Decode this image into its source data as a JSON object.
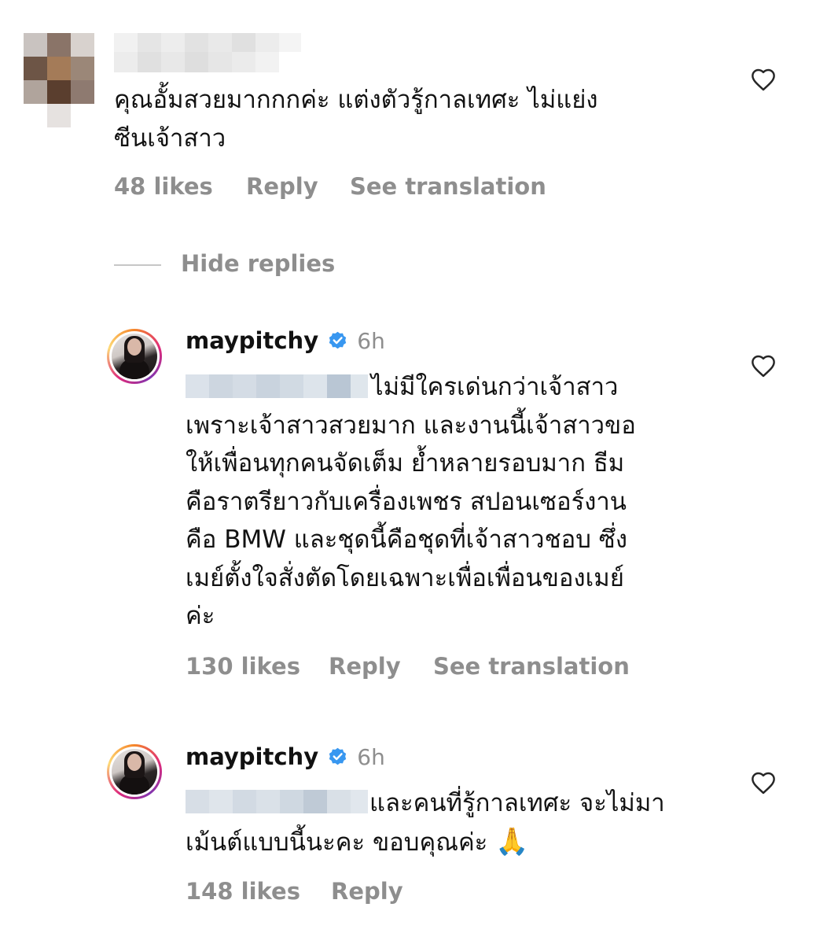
{
  "comment": {
    "text_line1": "คุณอั้มสวยมากกกค่ะ แต่งตัวรู้กาลเทศะ ไม่แย่ง",
    "text_line2": "ซีนเจ้าสาว",
    "likes": "48 likes",
    "reply": "Reply",
    "see_translation": "See translation"
  },
  "hide_replies": "Hide replies",
  "replies": [
    {
      "username": "maypitchy",
      "time": "6h",
      "lines": [
        "ไม่มีใครเด่นกว่าเจ้าสาว",
        "เพราะเจ้าสาวสวยมาก และงานนี้เจ้าสาวขอ",
        "ให้เพื่อนทุกคนจัดเต็ม ย้ำหลายรอบมาก ธีม",
        "คือราตรียาวกับเครื่องเพชร สปอนเซอร์งาน",
        "คือ BMW และชุดนี้คือชุดที่เจ้าสาวชอบ ซึ่ง",
        "เมย์ตั้งใจสั่งตัดโดยเฉพาะเพื่อเพื่อนของเมย์",
        "ค่ะ"
      ],
      "likes": "130 likes",
      "reply": "Reply",
      "see_translation": "See translation"
    },
    {
      "username": "maypitchy",
      "time": "6h",
      "lines": [
        "และคนที่รู้กาลเทศะ จะไม่มา",
        "เม้นต์แบบนี้นะคะ ขอบคุณค่ะ"
      ],
      "emoji": "🙏",
      "likes": "148 likes",
      "reply": "Reply"
    }
  ],
  "icons": {
    "like": "heart-outline-icon",
    "verified": "verified-badge-icon"
  },
  "colors": {
    "meta_gray": "#8e8e8e",
    "verified_blue": "#3897f0",
    "text": "#121212"
  }
}
